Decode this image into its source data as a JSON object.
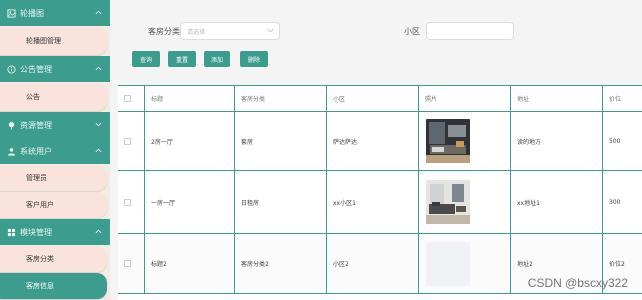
{
  "sidebar": {
    "sections": [
      {
        "title": "轮播图",
        "icon": "image-icon",
        "items": [
          "轮播图管理"
        ]
      },
      {
        "title": "公告管理",
        "icon": "info-icon",
        "items": [
          "公告"
        ]
      },
      {
        "title": "资源管理",
        "icon": "pin-icon",
        "items": []
      },
      {
        "title": "系统用户",
        "icon": "user-icon",
        "items": [
          "管理员",
          "客户用户"
        ]
      },
      {
        "title": "模块管理",
        "icon": "grid-icon",
        "items": [
          "客房分类",
          "客房信息"
        ]
      }
    ],
    "active_item": "客房信息"
  },
  "search": {
    "category_label": "客房分类",
    "category_placeholder": "请选择",
    "community_label": "小区",
    "community_value": ""
  },
  "actions": [
    "查询",
    "重置",
    "添加",
    "删除"
  ],
  "table": {
    "headers": [
      "",
      "标题",
      "客房分类",
      "小区",
      "照片",
      "地址",
      "价位"
    ],
    "rows": [
      {
        "title": "2房一厅",
        "category": "套房",
        "community": "萨达萨达",
        "photo": "living-room-dark",
        "address": "读的地方",
        "price": "500"
      },
      {
        "title": "一房一厅",
        "category": "日租房",
        "community": "xx小区1",
        "photo": "living-room-light",
        "address": "xx地址1",
        "price": "300"
      },
      {
        "title": "标题2",
        "category": "客房分类2",
        "community": "小区2",
        "photo": "blank",
        "address": "地址2",
        "price": "价位2"
      }
    ]
  },
  "watermark": "CSDN @bscxy322",
  "colors": {
    "accent": "#3c9c8e",
    "sidebar_item": "#f9e3dc",
    "sidebar_bg": "#f3ece6",
    "main_bg": "#f4f4f4"
  }
}
